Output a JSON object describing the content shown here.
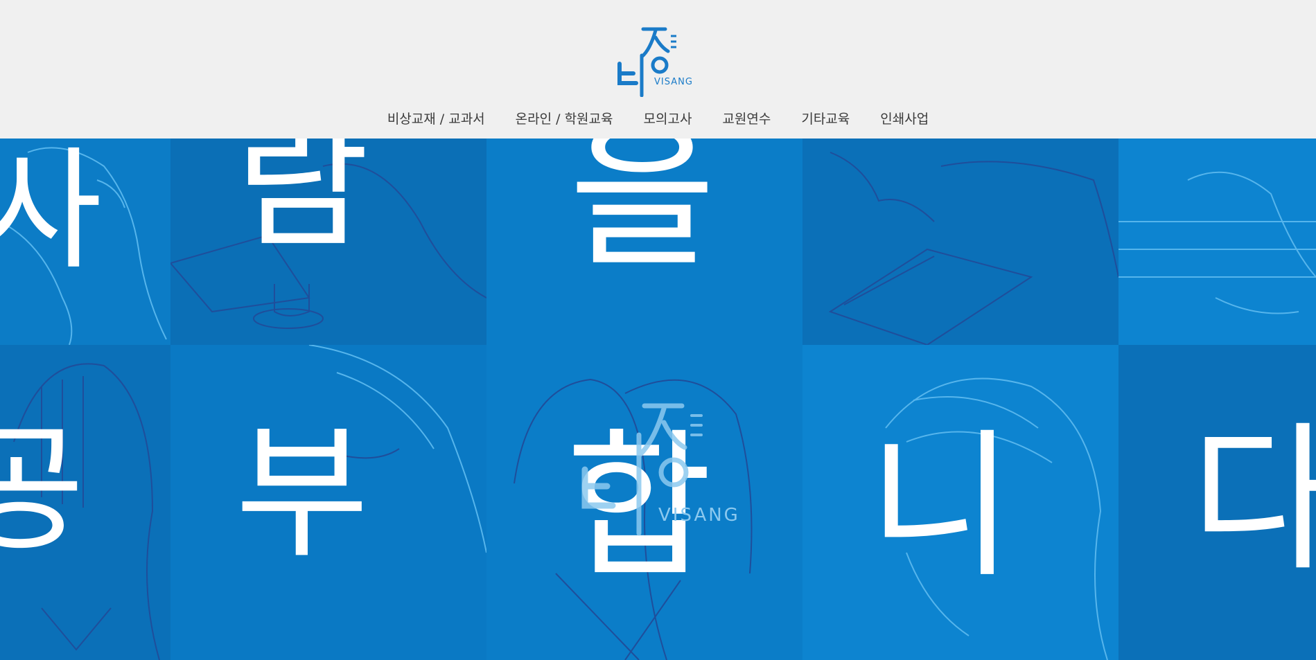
{
  "brand": {
    "logo_text": "VISANG",
    "logo_korean": "비상",
    "color_blue": "#1a7bc8"
  },
  "nav": {
    "items": [
      {
        "label": "비상교재 / 교과서"
      },
      {
        "label": "온라인 / 학원교육"
      },
      {
        "label": "모의고사"
      },
      {
        "label": "교원연수"
      },
      {
        "label": "기타교육"
      },
      {
        "label": "인쇄사업"
      }
    ]
  },
  "hero": {
    "top_row": [
      "사",
      "람",
      "을",
      "",
      ""
    ],
    "bottom_row": [
      "공",
      "부",
      "합",
      "니",
      "다"
    ],
    "watermark_text": "VISANG",
    "watermark_korean": "비상",
    "colors": {
      "tile_a": "#0a79c4",
      "tile_b": "#0b6fb6",
      "tile_c": "#0d84d0",
      "line": "#56b5ec"
    }
  }
}
